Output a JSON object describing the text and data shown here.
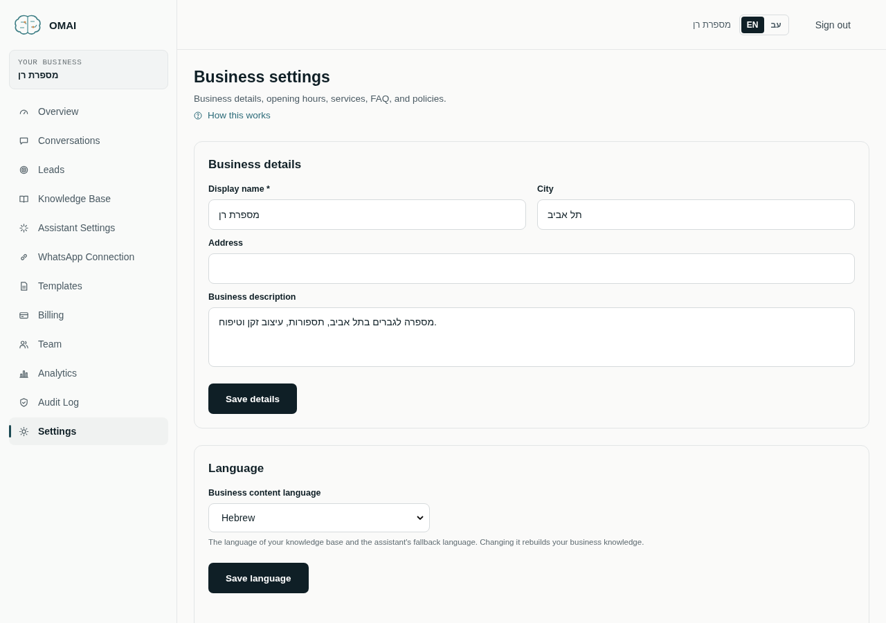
{
  "brand": {
    "name": "OMAI"
  },
  "business_card": {
    "caption": "YOUR BUSINESS",
    "name": "מספרת רן"
  },
  "sidebar": {
    "items": [
      {
        "label": "Overview",
        "selected": false
      },
      {
        "label": "Conversations",
        "selected": false
      },
      {
        "label": "Leads",
        "selected": false
      },
      {
        "label": "Knowledge Base",
        "selected": false
      },
      {
        "label": "Assistant Settings",
        "selected": false
      },
      {
        "label": "WhatsApp Connection",
        "selected": false
      },
      {
        "label": "Templates",
        "selected": false
      },
      {
        "label": "Billing",
        "selected": false
      },
      {
        "label": "Team",
        "selected": false
      },
      {
        "label": "Analytics",
        "selected": false
      },
      {
        "label": "Audit Log",
        "selected": false
      },
      {
        "label": "Settings",
        "selected": true
      }
    ]
  },
  "header": {
    "business_name": "מספרת רן",
    "language_toggle": [
      {
        "label": "EN",
        "selected": true
      },
      {
        "label": "עב",
        "selected": false
      }
    ],
    "sign_out": "Sign out"
  },
  "page": {
    "title": "Business settings",
    "subtitle": "Business details, opening hours, services, FAQ, and policies.",
    "help_link": "How this works"
  },
  "business_details": {
    "title": "Business details",
    "display_name": {
      "label": "Display name *",
      "value": "מספרת רן"
    },
    "city": {
      "label": "City",
      "value": "תל אביב"
    },
    "address": {
      "label": "Address"
    },
    "description": {
      "label": "Business description",
      "value": "מספרה לגברים בתל אביב, תספורות, עיצוב זקן וטיפוח."
    },
    "save_button": "Save details"
  },
  "language": {
    "title": "Language",
    "field_label": "Business content language",
    "value": "Hebrew",
    "hint": "The language of your knowledge base and the assistant's fallback language. Changing it rebuilds your business knowledge.",
    "save_button": "Save language"
  }
}
